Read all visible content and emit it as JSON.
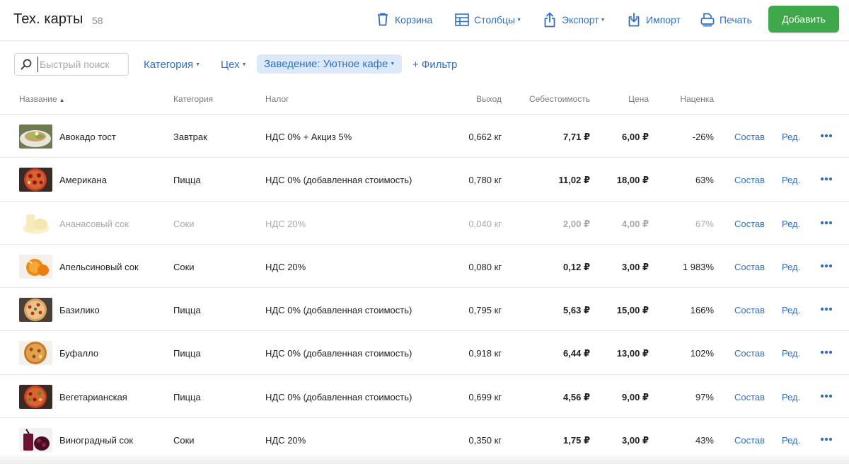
{
  "header": {
    "title": "Тех. карты",
    "count": "58",
    "toolbar": {
      "trash_label": "Корзина",
      "columns_label": "Столбцы",
      "export_label": "Экспорт",
      "import_label": "Импорт",
      "print_label": "Печать",
      "add_label": "Добавить"
    }
  },
  "filters": {
    "search_placeholder": "Быстрый поиск",
    "category_label": "Категория",
    "workshop_label": "Цех",
    "venue_label": "Заведение: Уютное кафе",
    "add_filter_label": "+ Фильтр"
  },
  "table": {
    "columns": {
      "name": "Название",
      "category": "Категория",
      "tax": "Налог",
      "yield": "Выход",
      "cost": "Себестоимость",
      "price": "Цена",
      "markup": "Наценка"
    },
    "compose_label": "Состав",
    "edit_label": "Ред.",
    "rows": [
      {
        "name": "Авокадо тост",
        "category": "Завтрак",
        "tax": "НДС 0% + Акциз 5%",
        "yield": "0,662 кг",
        "cost": "7,71 ₽",
        "price": "6,00 ₽",
        "markup": "-26%"
      },
      {
        "name": "Американа",
        "category": "Пицца",
        "tax": "НДС 0% (добавленная стоимость)",
        "yield": "0,780 кг",
        "cost": "11,02 ₽",
        "price": "18,00 ₽",
        "markup": "63%"
      },
      {
        "name": "Ананасовый сок",
        "category": "Соки",
        "tax": "НДС 20%",
        "yield": "0,040 кг",
        "cost": "2,00 ₽",
        "price": "4,00 ₽",
        "markup": "67%"
      },
      {
        "name": "Апельсиновый сок",
        "category": "Соки",
        "tax": "НДС 20%",
        "yield": "0,080 кг",
        "cost": "0,12 ₽",
        "price": "3,00 ₽",
        "markup": "1 983%"
      },
      {
        "name": "Базилико",
        "category": "Пицца",
        "tax": "НДС 0% (добавленная стоимость)",
        "yield": "0,795 кг",
        "cost": "5,63 ₽",
        "price": "15,00 ₽",
        "markup": "166%"
      },
      {
        "name": "Буфалло",
        "category": "Пицца",
        "tax": "НДС 0% (добавленная стоимость)",
        "yield": "0,918 кг",
        "cost": "6,44 ₽",
        "price": "13,00 ₽",
        "markup": "102%"
      },
      {
        "name": "Вегетарианская",
        "category": "Пицца",
        "tax": "НДС 0% (добавленная стоимость)",
        "yield": "0,699 кг",
        "cost": "4,56 ₽",
        "price": "9,00 ₽",
        "markup": "97%"
      },
      {
        "name": "Виноградный сок",
        "category": "Соки",
        "tax": "НДС 20%",
        "yield": "0,350 кг",
        "cost": "1,75 ₽",
        "price": "3,00 ₽",
        "markup": "43%"
      }
    ]
  },
  "colors": {
    "accent": "#2f6fc4",
    "add_button": "#3fa84a",
    "active_filter_bg": "#dbe9fb"
  }
}
